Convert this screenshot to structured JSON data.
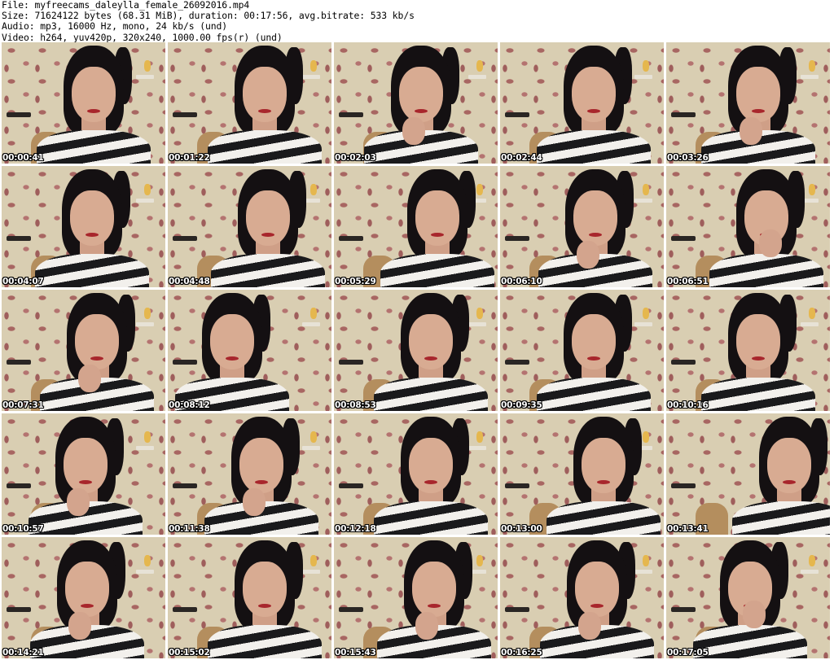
{
  "header": {
    "file_line": "File: myfreecams_daleylla_female_26092016.mp4",
    "size_line": "Size: 71624122 bytes (68.31 MiB), duration: 00:17:56, avg.bitrate: 533 kb/s",
    "audio_line": "Audio: mp3, 16000 Hz, mono, 24 kb/s (und)",
    "video_line": "Video: h264, yuv420p, 320x240, 1000.00 fps(r) (und)"
  },
  "thumbnails": [
    {
      "timestamp": "00:00:41"
    },
    {
      "timestamp": "00:01:22"
    },
    {
      "timestamp": "00:02:03"
    },
    {
      "timestamp": "00:02:44"
    },
    {
      "timestamp": "00:03:26"
    },
    {
      "timestamp": "00:04:07"
    },
    {
      "timestamp": "00:04:48"
    },
    {
      "timestamp": "00:05:29"
    },
    {
      "timestamp": "00:06:10"
    },
    {
      "timestamp": "00:06:51"
    },
    {
      "timestamp": "00:07:31"
    },
    {
      "timestamp": "00:08:12"
    },
    {
      "timestamp": "00:08:53"
    },
    {
      "timestamp": "00:09:35"
    },
    {
      "timestamp": "00:10:16"
    },
    {
      "timestamp": "00:10:57"
    },
    {
      "timestamp": "00:11:38"
    },
    {
      "timestamp": "00:12:18"
    },
    {
      "timestamp": "00:13:00"
    },
    {
      "timestamp": "00:13:41"
    },
    {
      "timestamp": "00:14:21"
    },
    {
      "timestamp": "00:15:02"
    },
    {
      "timestamp": "00:15:43"
    },
    {
      "timestamp": "00:16:25"
    },
    {
      "timestamp": "00:17:05"
    }
  ],
  "colors": {
    "wallpaper": "#d9ceb2",
    "flower_pattern": "#a86662",
    "hair": "#141012",
    "skin": "#d8ab92",
    "lips": "#a8262c",
    "shirt_dark": "#1a1a1c",
    "shirt_light": "#f2f0ec"
  }
}
